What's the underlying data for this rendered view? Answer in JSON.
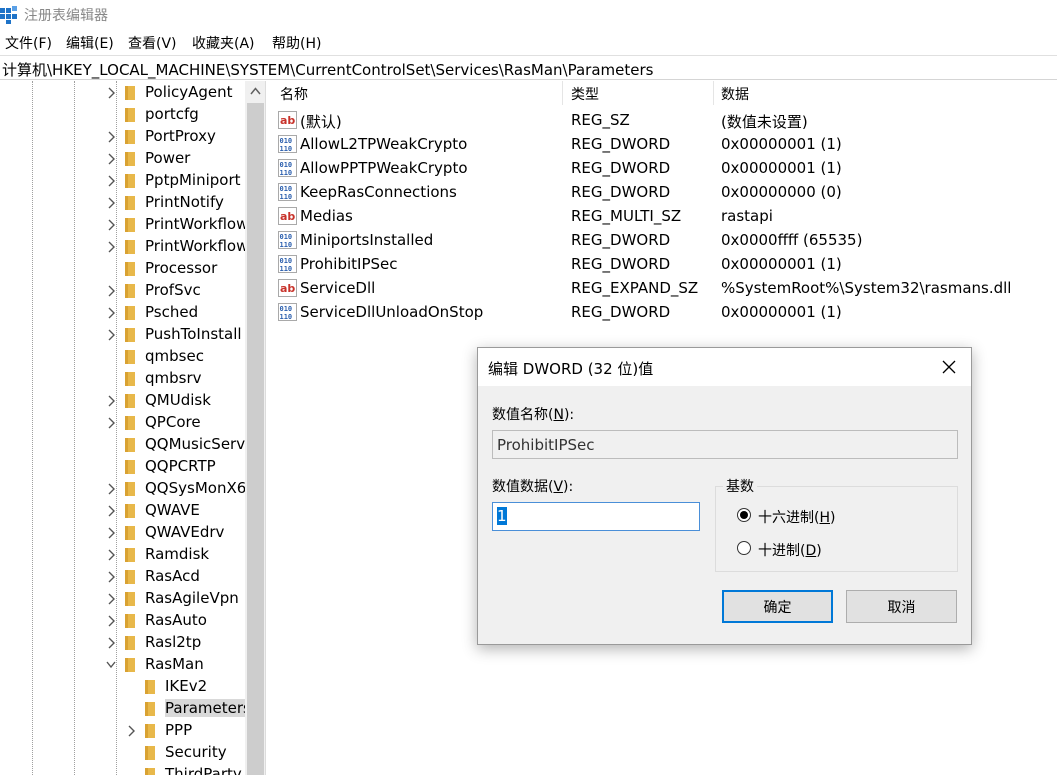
{
  "window": {
    "title": "注册表编辑器"
  },
  "menu": [
    "文件(F)",
    "编辑(E)",
    "查看(V)",
    "收藏夹(A)",
    "帮助(H)"
  ],
  "address": "计算机\\HKEY_LOCAL_MACHINE\\SYSTEM\\CurrentControlSet\\Services\\RasMan\\Parameters",
  "tree": {
    "items": [
      {
        "label": "PolicyAgent",
        "level": 0,
        "expander": "collapsed"
      },
      {
        "label": "portcfg",
        "level": 0,
        "expander": "none"
      },
      {
        "label": "PortProxy",
        "level": 0,
        "expander": "collapsed"
      },
      {
        "label": "Power",
        "level": 0,
        "expander": "collapsed"
      },
      {
        "label": "PptpMiniport",
        "level": 0,
        "expander": "collapsed"
      },
      {
        "label": "PrintNotify",
        "level": 0,
        "expander": "collapsed"
      },
      {
        "label": "PrintWorkflow",
        "level": 0,
        "expander": "collapsed"
      },
      {
        "label": "PrintWorkflow",
        "level": 0,
        "expander": "collapsed"
      },
      {
        "label": "Processor",
        "level": 0,
        "expander": "none"
      },
      {
        "label": "ProfSvc",
        "level": 0,
        "expander": "collapsed"
      },
      {
        "label": "Psched",
        "level": 0,
        "expander": "collapsed"
      },
      {
        "label": "PushToInstall",
        "level": 0,
        "expander": "collapsed"
      },
      {
        "label": "qmbsec",
        "level": 0,
        "expander": "none"
      },
      {
        "label": "qmbsrv",
        "level": 0,
        "expander": "none"
      },
      {
        "label": "QMUdisk",
        "level": 0,
        "expander": "collapsed"
      },
      {
        "label": "QPCore",
        "level": 0,
        "expander": "collapsed"
      },
      {
        "label": "QQMusicServ",
        "level": 0,
        "expander": "none"
      },
      {
        "label": "QQPCRTP",
        "level": 0,
        "expander": "none"
      },
      {
        "label": "QQSysMonX6",
        "level": 0,
        "expander": "collapsed"
      },
      {
        "label": "QWAVE",
        "level": 0,
        "expander": "collapsed"
      },
      {
        "label": "QWAVEdrv",
        "level": 0,
        "expander": "collapsed"
      },
      {
        "label": "Ramdisk",
        "level": 0,
        "expander": "collapsed"
      },
      {
        "label": "RasAcd",
        "level": 0,
        "expander": "collapsed"
      },
      {
        "label": "RasAgileVpn",
        "level": 0,
        "expander": "collapsed"
      },
      {
        "label": "RasAuto",
        "level": 0,
        "expander": "collapsed"
      },
      {
        "label": "Rasl2tp",
        "level": 0,
        "expander": "collapsed"
      },
      {
        "label": "RasMan",
        "level": 0,
        "expander": "expanded"
      },
      {
        "label": "IKEv2",
        "level": 1,
        "expander": "none"
      },
      {
        "label": "Parameters",
        "level": 1,
        "expander": "none",
        "selected": true
      },
      {
        "label": "PPP",
        "level": 1,
        "expander": "collapsed"
      },
      {
        "label": "Security",
        "level": 1,
        "expander": "none"
      },
      {
        "label": "ThirdParty",
        "level": 1,
        "expander": "none"
      }
    ]
  },
  "list": {
    "headers": {
      "name": "名称",
      "type": "类型",
      "data": "数据"
    },
    "rows": [
      {
        "name": "(默认)",
        "type": "REG_SZ",
        "data": "(数值未设置)",
        "icon": "string-value-icon"
      },
      {
        "name": "AllowL2TPWeakCrypto",
        "type": "REG_DWORD",
        "data": "0x00000001 (1)",
        "icon": "binary-value-icon"
      },
      {
        "name": "AllowPPTPWeakCrypto",
        "type": "REG_DWORD",
        "data": "0x00000001 (1)",
        "icon": "binary-value-icon"
      },
      {
        "name": "KeepRasConnections",
        "type": "REG_DWORD",
        "data": "0x00000000 (0)",
        "icon": "binary-value-icon"
      },
      {
        "name": "Medias",
        "type": "REG_MULTI_SZ",
        "data": "rastapi",
        "icon": "string-value-icon"
      },
      {
        "name": "MiniportsInstalled",
        "type": "REG_DWORD",
        "data": "0x0000ffff (65535)",
        "icon": "binary-value-icon"
      },
      {
        "name": "ProhibitIPSec",
        "type": "REG_DWORD",
        "data": "0x00000001 (1)",
        "icon": "binary-value-icon"
      },
      {
        "name": "ServiceDll",
        "type": "REG_EXPAND_SZ",
        "data": "%SystemRoot%\\System32\\rasmans.dll",
        "icon": "string-value-icon"
      },
      {
        "name": "ServiceDllUnloadOnStop",
        "type": "REG_DWORD",
        "data": "0x00000001 (1)",
        "icon": "binary-value-icon"
      }
    ]
  },
  "dialog": {
    "title": "编辑 DWORD (32 位)值",
    "name_label_pre": "数值名称(",
    "name_label_key": "N",
    "name_label_post": "):",
    "name_value": "ProhibitIPSec",
    "data_label_pre": "数值数据(",
    "data_label_key": "V",
    "data_label_post": "):",
    "data_value": "1",
    "base_label": "基数",
    "hex_label_pre": "十六进制(",
    "hex_label_key": "H",
    "hex_label_post": ")",
    "dec_label_pre": "十进制(",
    "dec_label_key": "D",
    "dec_label_post": ")",
    "selected_base": "hex",
    "ok_label": "确定",
    "cancel_label": "取消"
  },
  "colors": {
    "folder": "#e8b84a",
    "accent": "#0078d7",
    "selection": "#d9d9d9"
  }
}
